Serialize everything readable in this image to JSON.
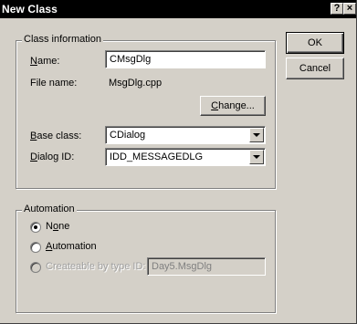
{
  "window": {
    "title": "New Class",
    "help_glyph": "?",
    "close_glyph": "×"
  },
  "class_info": {
    "group_label": "Class information",
    "name_label_ul": "N",
    "name_label_rest": "ame:",
    "name_value": "CMsgDlg",
    "file_label": "File name:",
    "file_value": "MsgDlg.cpp",
    "change_ul": "C",
    "change_rest": "hange...",
    "base_label_ul": "B",
    "base_label_rest": "ase class:",
    "base_value": "CDialog",
    "dialog_label_ul": "D",
    "dialog_label_rest": "ialog ID:",
    "dialog_value": "IDD_MESSAGEDLG"
  },
  "buttons": {
    "ok": "OK",
    "cancel": "Cancel"
  },
  "automation": {
    "group_label": "Automation",
    "none_pre": "N",
    "none_ul": "o",
    "none_post": "ne",
    "auto_ul": "A",
    "auto_rest": "utomation",
    "createable_label": "Createable by type ID:",
    "type_id_value": "Day5.MsgDlg",
    "selected": "None"
  }
}
